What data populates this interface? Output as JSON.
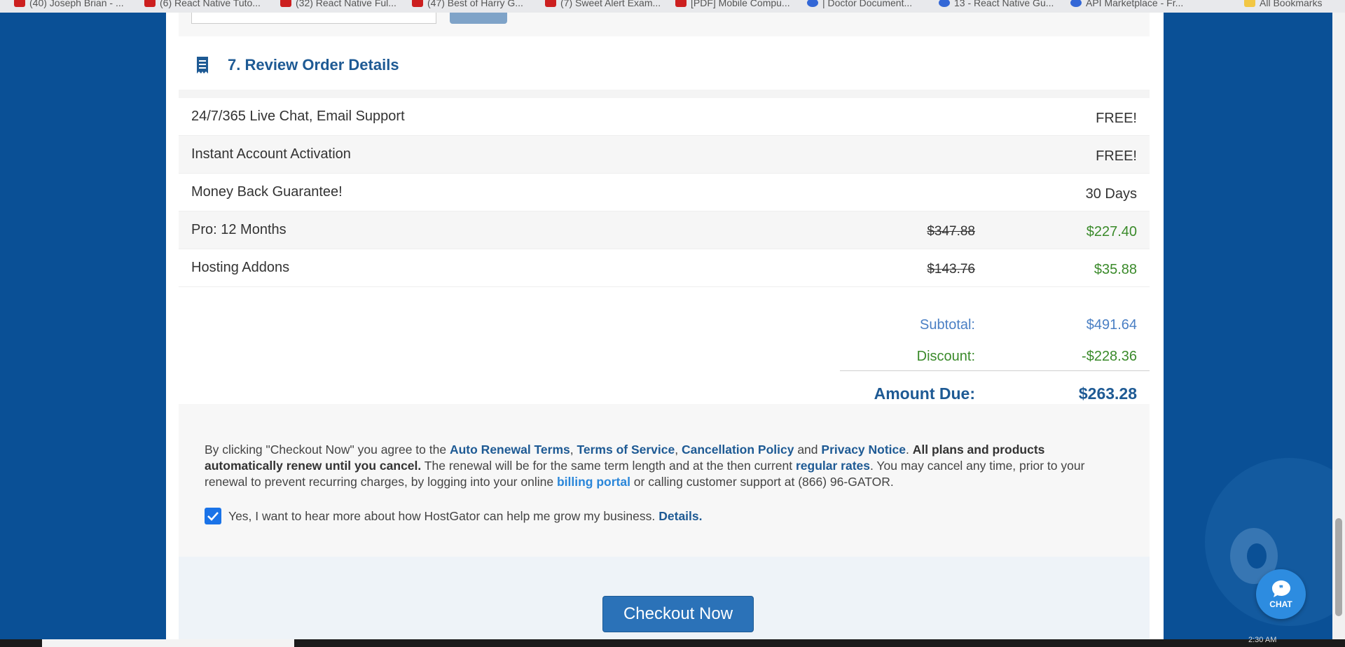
{
  "bookmarks": [
    {
      "label": "(40) Joseph Brian - ..."
    },
    {
      "label": "(6) React Native Tuto..."
    },
    {
      "label": "(32) React Native Ful..."
    },
    {
      "label": "(47) Best of Harry G..."
    },
    {
      "label": "(7) Sweet Alert Exam..."
    },
    {
      "label": "[PDF] Mobile Compu..."
    },
    {
      "label": "| Doctor Document..."
    },
    {
      "label": "13 - React Native Gu..."
    },
    {
      "label": "API Marketplace - Fr..."
    },
    {
      "label": "All Bookmarks"
    }
  ],
  "section": {
    "number_title": "7. Review Order Details",
    "icon": "receipt-icon"
  },
  "order_rows": [
    {
      "label": "24/7/365 Live Chat, Email Support",
      "original": "",
      "value": "FREE!",
      "value_color": "default"
    },
    {
      "label": "Instant Account Activation",
      "original": "",
      "value": "FREE!",
      "value_color": "default"
    },
    {
      "label": "Money Back Guarantee!",
      "original": "",
      "value": "30 Days",
      "value_color": "default"
    },
    {
      "label": "Pro: 12 Months",
      "original": "$347.88",
      "value": "$227.40",
      "value_color": "green"
    },
    {
      "label": "Hosting Addons",
      "original": "$143.76",
      "value": "$35.88",
      "value_color": "green"
    }
  ],
  "totals": {
    "subtotal_label": "Subtotal:",
    "subtotal_value": "$491.64",
    "discount_label": "Discount:",
    "discount_value": "-$228.36",
    "amount_due_label": "Amount Due:",
    "amount_due_value": "$263.28"
  },
  "terms": {
    "t1": "By clicking \"Checkout Now\" you agree to the ",
    "link_auto_renewal": "Auto Renewal Terms",
    "sep1": ", ",
    "link_tos": "Terms of Service",
    "sep2": ", ",
    "link_cancellation": "Cancellation Policy",
    "and": " and ",
    "link_privacy": "Privacy Notice",
    "dot": ". ",
    "bold_renew": "All plans and products automatically renew until you cancel.",
    "t2": " The renewal will be for the same term length and at the then current ",
    "link_regular_rates": "regular rates",
    "t3": ". You may cancel any time, prior to your renewal to prevent recurring charges, by logging into your online ",
    "link_billing_portal": "billing portal",
    "t4": " or calling customer support at (866) 96-GATOR."
  },
  "optin": {
    "checked": true,
    "text": "Yes, I want to hear more about how HostGator can help me grow my business.",
    "link": "Details."
  },
  "checkout": {
    "label": "Checkout Now"
  },
  "chat": {
    "label": "CHAT"
  },
  "taskbar": {
    "time": "2:30 AM"
  },
  "colors": {
    "background": "#0a5096",
    "heading": "#1e5a94",
    "green": "#3a8a2a",
    "subtotal": "#4a7fc4",
    "button": "#2b72b8"
  }
}
